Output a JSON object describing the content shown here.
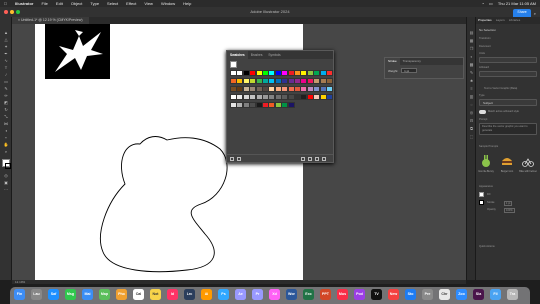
{
  "menubar": {
    "app": "Illustrator",
    "items": [
      "File",
      "Edit",
      "Object",
      "Type",
      "Select",
      "Effect",
      "View",
      "Window",
      "Help"
    ],
    "clock": "Thu 21 Mar  11:05 AM"
  },
  "window": {
    "title": "Adobe Illustrator 2024",
    "share_label": "Share"
  },
  "document_tab": {
    "label": "Untitled-1* @ 12.19 % (CMYK/Preview)"
  },
  "status": {
    "zoom": "12.19%"
  },
  "swatches": {
    "tabs": [
      "Swatches",
      "Brushes",
      "Symbols"
    ],
    "rows": [
      [
        "#ffffff",
        "#ffffff",
        "#000000",
        "#ff0000",
        "#ffff00",
        "#00ff00",
        "#00ffff",
        "#0000ff",
        "#ff00ff",
        "#ed1c24",
        "#f7941d",
        "#fff200",
        "#8dc63f",
        "#00a651",
        "#00aeef",
        "#ff2d2d"
      ],
      [
        "#f26522",
        "#fcbc00",
        "#fff568",
        "#c0d730",
        "#39b54a",
        "#00a99d",
        "#00bff3",
        "#0072bc",
        "#2e3192",
        "#662d91",
        "#92278f",
        "#ec008c",
        "#ed145b",
        "#c69c6d",
        "#a67c52",
        "#8c6239"
      ],
      [
        "#754c24",
        "#603913",
        "#c7b299",
        "#998675",
        "#736357",
        "#534741",
        "#ffd3a2",
        "#f9ad81",
        "#f7977a",
        "#f26c4f",
        "#e25a3c",
        "#f06eaa",
        "#bd8cbf",
        "#8493ca",
        "#5574b9",
        "#6dcff6"
      ],
      [
        "#ffffff",
        "#ebebeb",
        "#d7d7d7",
        "#c2c2c2",
        "#adadad",
        "#999999",
        "#848484",
        "#707070",
        "#5c5c5c",
        "#474747",
        "#333333",
        "#1f1f1f",
        "#ff0000",
        "#f7c8b8",
        "#ffd200",
        "#21409a"
      ],
      [
        "#e5e5e5",
        "#b3b3b3",
        "#808080",
        "#4d4d4d",
        "#1a1a1a",
        "#ed1c24",
        "#f15a24",
        "#8cc63f",
        "#009245",
        "#1b1464"
      ]
    ]
  },
  "stroke_panel": {
    "tabs": [
      "Stroke",
      "Transparency"
    ],
    "weight_label": "Weight:",
    "weight_value": "1 pt"
  },
  "properties": {
    "tabs": [
      "Properties",
      "Layers",
      "Libraries"
    ],
    "no_selection": "No Selection",
    "transform": "Transform",
    "document_label": "Document",
    "units": "Units",
    "artboard": "Artboard",
    "edit_artboards": "Edit Artboards",
    "generate_label": "Text to Vector Graphic (Beta)",
    "type_label": "Type",
    "type_value": "Subject",
    "match_label": "Match active artboard style",
    "prompt_label": "Prompt",
    "prompt_text": "Describe the vector graphic you want to generate",
    "samples_label": "Sample Prompts",
    "samples": [
      "Icon lite Bunny",
      "Burger Icon",
      "Bike with helmet"
    ],
    "appearance": "Appearance",
    "fill": "Fill",
    "stroke": "Stroke",
    "stroke_value": "1 pt",
    "opacity": "Opacity",
    "opacity_value": "100%",
    "quick_actions": "Quick Actions"
  },
  "dock": {
    "apps": [
      {
        "label": "Finder",
        "color": "#3d8df5"
      },
      {
        "label": "Launch",
        "color": "#888888"
      },
      {
        "label": "Safari",
        "color": "#1e90ff"
      },
      {
        "label": "Msg",
        "color": "#30c84e"
      },
      {
        "label": "Mail",
        "color": "#3a8ef6"
      },
      {
        "label": "Maps",
        "color": "#5bbf5b"
      },
      {
        "label": "Photos",
        "color": "#f0a030"
      },
      {
        "label": "Cal",
        "color": "#ffffff"
      },
      {
        "label": "Notes",
        "color": "#f7d34a"
      },
      {
        "label": "Id",
        "color": "#ff3366"
      },
      {
        "label": "Lrc",
        "color": "#2b3e5c"
      },
      {
        "label": "Ai",
        "color": "#ff9a00"
      },
      {
        "label": "Ps",
        "color": "#31a8ff"
      },
      {
        "label": "Ae",
        "color": "#9999ff"
      },
      {
        "label": "Pr",
        "color": "#9999ff"
      },
      {
        "label": "Xd",
        "color": "#ff61f6"
      },
      {
        "label": "Word",
        "color": "#2b579a"
      },
      {
        "label": "Excel",
        "color": "#217346"
      },
      {
        "label": "PPT",
        "color": "#d24726"
      },
      {
        "label": "Music",
        "color": "#fa2d48"
      },
      {
        "label": "Pod",
        "color": "#9c3fe6"
      },
      {
        "label": "TV",
        "color": "#111111"
      },
      {
        "label": "News",
        "color": "#f54040"
      },
      {
        "label": "Store",
        "color": "#1e7cf2"
      },
      {
        "label": "Prefs",
        "color": "#8a8a8a"
      },
      {
        "label": "Chrome",
        "color": "#e8e8e8"
      },
      {
        "label": "Zoom",
        "color": "#2d8cff"
      },
      {
        "label": "Slack",
        "color": "#4a154b"
      },
      {
        "label": "Files",
        "color": "#4aa3f2"
      },
      {
        "label": "Trash",
        "color": "#b8b8b8"
      }
    ]
  }
}
